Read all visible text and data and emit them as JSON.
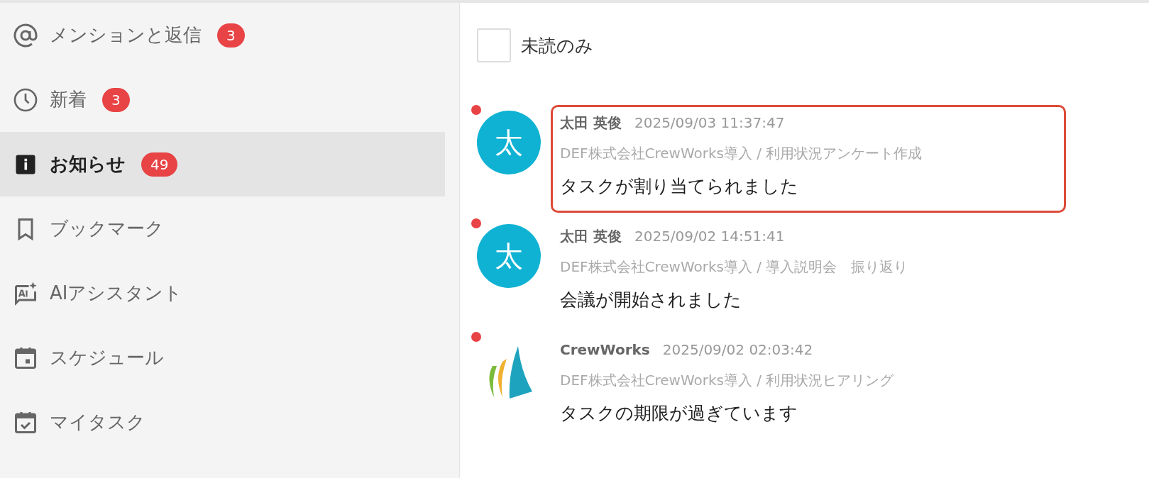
{
  "sidebar": {
    "items": [
      {
        "label": "メンションと返信",
        "badge": "3",
        "selected": false
      },
      {
        "label": "新着",
        "badge": "3",
        "selected": false
      },
      {
        "label": "お知らせ",
        "badge": "49",
        "selected": true
      },
      {
        "label": "ブックマーク",
        "selected": false
      },
      {
        "label": "AIアシスタント",
        "selected": false
      },
      {
        "label": "スケジュール",
        "selected": false
      },
      {
        "label": "マイタスク",
        "selected": false
      }
    ]
  },
  "filter": {
    "label": "未読のみ",
    "checked": false
  },
  "notifications": [
    {
      "avatar": {
        "kind": "initial",
        "text": "太"
      },
      "sender": "太田 英俊",
      "time": "2025/09/03 11:37:47",
      "context": "DEF株式会社CrewWorks導入 / 利用状況アンケート作成",
      "message": "タスクが割り当てられました",
      "unread": true,
      "highlighted": true
    },
    {
      "avatar": {
        "kind": "initial",
        "text": "太"
      },
      "sender": "太田 英俊",
      "time": "2025/09/02 14:51:41",
      "context": "DEF株式会社CrewWorks導入 / 導入説明会　振り返り",
      "message": "会議が開始されました",
      "unread": true,
      "highlighted": false
    },
    {
      "avatar": {
        "kind": "logo"
      },
      "sender": "CrewWorks",
      "time": "2025/09/02 02:03:42",
      "context": "DEF株式会社CrewWorks導入 / 利用状況ヒアリング",
      "message": "タスクの期限が過ぎています",
      "unread": true,
      "highlighted": false
    }
  ]
}
